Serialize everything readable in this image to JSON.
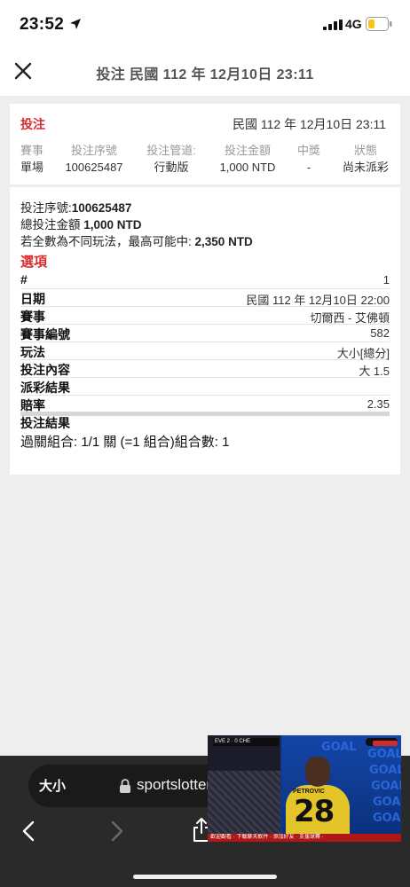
{
  "status_bar": {
    "time": "23:52",
    "network": "4G",
    "battery_color": "#f5c518"
  },
  "header": {
    "title": "投注 民國 112 年 12月10日 23:11"
  },
  "bet_card": {
    "title": "投注",
    "date": "民國 112 年 12月10日 23:11",
    "columns": [
      {
        "header": "賽事",
        "value": "單場"
      },
      {
        "header": "投注序號",
        "value": "100625487"
      },
      {
        "header": "投注管道:",
        "value": "行動版"
      },
      {
        "header": "投注金額",
        "value": "1,000 NTD"
      },
      {
        "header": "中獎",
        "value": "-"
      },
      {
        "header": "狀態",
        "value": "尚未派彩"
      }
    ]
  },
  "detail": {
    "serial_label": "投注序號:",
    "serial_value": "100625487",
    "total_label": "總投注金額",
    "total_value": "1,000 NTD",
    "max_label": "若全數為不同玩法，最高可能中:",
    "max_value": "2,350 NTD",
    "options_title": "選項",
    "rows": [
      {
        "label": "#",
        "value": "1"
      },
      {
        "label": "日期",
        "value": "民國 112 年 12月10日 22:00"
      },
      {
        "label": "賽事",
        "value": "切爾西 - 艾佛頓"
      },
      {
        "label": "賽事編號",
        "value": "582"
      },
      {
        "label": "玩法",
        "value": "大小[總分]"
      },
      {
        "label": "投注內容",
        "value": "大 1.5"
      },
      {
        "label": "派彩結果",
        "value": ""
      },
      {
        "label": "賠率",
        "value": "2.35"
      }
    ],
    "result_label": "投注結果",
    "combo_text": "過關組合: 1/1 關 (=1 組合)組合數: 1"
  },
  "browser": {
    "text_size_label": "大小",
    "url": "sportslottery.com.tw"
  },
  "video": {
    "jersey_name": "PETROVIC",
    "jersey_number": "28",
    "scoreboard": "EVE 2 · 0 CHE",
    "wall_text": [
      "GOAL",
      "GOAL",
      "GOAL",
      "GOAL",
      "GOAL",
      "GOAL"
    ],
    "ticker": "歡迎觀看 · 下載聊天軟件 · 添加好友 · 支援球賽 ·"
  }
}
